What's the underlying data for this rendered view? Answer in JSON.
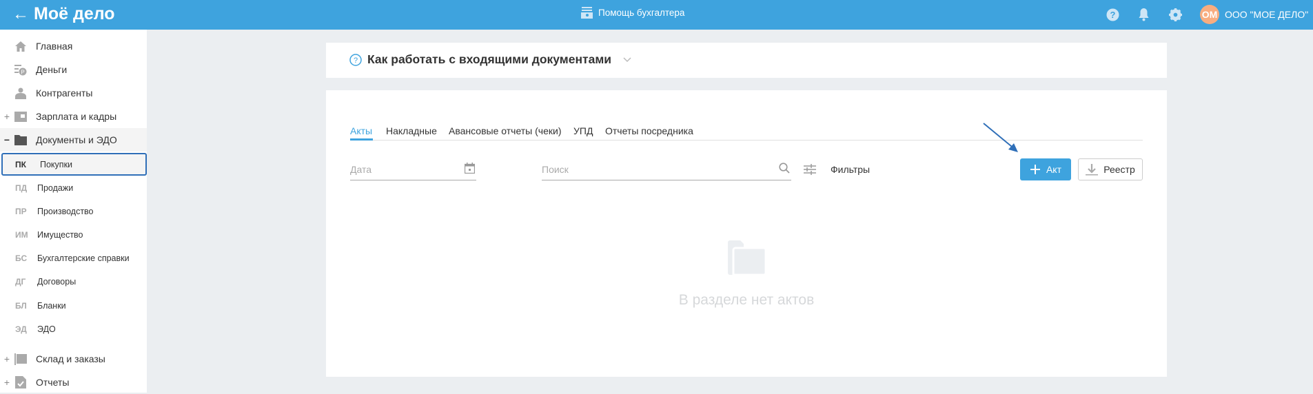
{
  "header": {
    "logo": "Моё дело",
    "helper": "Помощь бухгалтера",
    "avatar": "ОМ",
    "company": "ООО \"МОЕ ДЕЛО\""
  },
  "sidebar": {
    "items": [
      {
        "label": "Главная",
        "icon": "home-icon"
      },
      {
        "label": "Деньги",
        "icon": "money-icon"
      },
      {
        "label": "Контрагенты",
        "icon": "contractor-icon"
      },
      {
        "label": "Зарплата и кадры",
        "icon": "wallet-icon",
        "toggle": "+"
      },
      {
        "label": "Документы и ЭДО",
        "icon": "folder-icon",
        "toggle": "−"
      }
    ],
    "subitems": [
      {
        "abbr": "ПК",
        "label": "Покупки"
      },
      {
        "abbr": "ПД",
        "label": "Продажи"
      },
      {
        "abbr": "ПР",
        "label": "Производство"
      },
      {
        "abbr": "ИМ",
        "label": "Имущество"
      },
      {
        "abbr": "БС",
        "label": "Бухгалтерские справки"
      },
      {
        "abbr": "ДГ",
        "label": "Договоры"
      },
      {
        "abbr": "БЛ",
        "label": "Бланки"
      },
      {
        "abbr": "ЭД",
        "label": "ЭДО"
      }
    ],
    "bottom": [
      {
        "label": "Склад и заказы",
        "toggle": "+"
      },
      {
        "label": "Отчеты",
        "toggle": "+"
      }
    ]
  },
  "help_card": {
    "title": "Как работать с входящими документами"
  },
  "tabs": [
    "Акты",
    "Накладные",
    "Авансовые отчеты (чеки)",
    "УПД",
    "Отчеты посредника"
  ],
  "filters": {
    "date_placeholder": "Дата",
    "search_placeholder": "Поиск",
    "filters_label": "Фильтры"
  },
  "buttons": {
    "add": "Акт",
    "registry": "Реестр"
  },
  "empty": "В разделе нет актов",
  "colors": {
    "accent": "#3ea3de",
    "avatar": "#f8ad80",
    "active_border": "#2f6fb8"
  }
}
